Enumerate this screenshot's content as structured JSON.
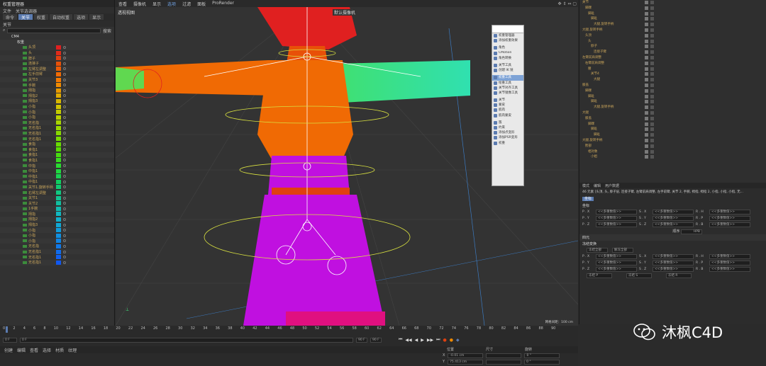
{
  "left_panel": {
    "title": "权重管理器",
    "menu": [
      "文件",
      "关节选调器"
    ],
    "tabs": [
      "命令",
      "关节",
      "权重",
      "自动权重",
      "选项",
      "显示"
    ],
    "active_tab": "关节",
    "section": "关节",
    "search_label": "搜索",
    "root": "CM4",
    "group": "权重",
    "joints": [
      {
        "name": "头顶",
        "color": "#e02020"
      },
      {
        "name": "头",
        "color": "#e02a1a"
      },
      {
        "name": "脖子",
        "color": "#e04010"
      },
      {
        "name": "连接子",
        "color": "#e85008"
      },
      {
        "name": "左臂左调整",
        "color": "#ec5c06"
      },
      {
        "name": "左手前臂",
        "color": "#f06a04"
      },
      {
        "name": "关节3",
        "color": "#f47a02"
      },
      {
        "name": "手腕",
        "color": "#f08a00"
      },
      {
        "name": "拇指",
        "color": "#e89a00"
      },
      {
        "name": "拇指2",
        "color": "#e0aa00"
      },
      {
        "name": "拇指3",
        "color": "#d8b800"
      },
      {
        "name": "小指",
        "color": "#d0c400"
      },
      {
        "name": "小指",
        "color": "#c4cc00"
      },
      {
        "name": "小指",
        "color": "#b8d000"
      },
      {
        "name": "无名指",
        "color": "#a8d400"
      },
      {
        "name": "无名指1",
        "color": "#98d800"
      },
      {
        "name": "无名指1",
        "color": "#88da00"
      },
      {
        "name": "无名指1",
        "color": "#78dc00"
      },
      {
        "name": "食指",
        "color": "#68dc00"
      },
      {
        "name": "食指1",
        "color": "#58dc00"
      },
      {
        "name": "食指1",
        "color": "#48dc10"
      },
      {
        "name": "食指1",
        "color": "#38dc20"
      },
      {
        "name": "中指",
        "color": "#28dc30"
      },
      {
        "name": "中指1",
        "color": "#20d840"
      },
      {
        "name": "中指1",
        "color": "#18d450"
      },
      {
        "name": "中指1",
        "color": "#10d060"
      },
      {
        "name": "关节1.旋转手柄",
        "color": "#10cc70"
      },
      {
        "name": "右臂左调整",
        "color": "#10c880"
      },
      {
        "name": "关节1",
        "color": "#10c490"
      },
      {
        "name": "关节2",
        "color": "#10c0a0"
      },
      {
        "name": "1手腕",
        "color": "#10bcb0"
      },
      {
        "name": "拇指",
        "color": "#10b8c0"
      },
      {
        "name": "拇指2",
        "color": "#10b0cc"
      },
      {
        "name": "拇指3",
        "color": "#10a8d4"
      },
      {
        "name": "小指",
        "color": "#109cdc"
      },
      {
        "name": "小指",
        "color": "#1090e0"
      },
      {
        "name": "小指",
        "color": "#1084e4"
      },
      {
        "name": "无名指",
        "color": "#1078e8"
      },
      {
        "name": "无名指1",
        "color": "#106cec"
      },
      {
        "name": "无名指1",
        "color": "#1060f0"
      },
      {
        "name": "无名指1",
        "color": "#1058f0"
      }
    ]
  },
  "viewport": {
    "menu": [
      "查看",
      "摄像机",
      "显示",
      "选项",
      "过滤",
      "面板",
      "ProRender"
    ],
    "highlight_menu": "选项",
    "camera_label": "透视视图",
    "camera_name": "默认摄像机",
    "grid_label": "网格间距：100 cm"
  },
  "context_menu": {
    "items": [
      "权重管理器",
      "添加权重效果",
      "",
      "角色",
      "CMotion",
      "角色转换",
      "",
      "关节工具",
      "创建 IK 链",
      "",
      "权重工具",
      "绘重工具",
      "关节对齐工具",
      "关节镜像工具",
      "",
      "关节",
      "蒙皮",
      "肌肉",
      "肌肉蒙皮",
      "",
      "簇",
      "约束",
      "添加点变形",
      "添加PSR变形",
      "权重"
    ],
    "selected": "权重工具"
  },
  "object_manager": {
    "rows": [
      "关节",
      "脚踝",
      "脚趾",
      "脚趾",
      "大腿.旋转手柄",
      "大腿.旋转手柄",
      "头顶",
      "头",
      "脖子",
      "连接子臂",
      "左臂前肩调整",
      "右臂前肩调整",
      "腰",
      "关节4",
      "大腿",
      "膝盖",
      "脚踝",
      "脚趾",
      "脚趾",
      "大腿.旋转手柄",
      "大腿",
      "膝盖",
      "脚踝",
      "脚趾",
      "脚趾",
      "大腿.旋转手柄",
      "胯部",
      "相对象",
      "小姐"
    ]
  },
  "attributes": {
    "tabs": [
      "模式",
      "编辑",
      "用户数据"
    ],
    "header": "46 元素 [头顶, 头, 脖子层, 连接子臂, 左臂前肩调整, 左手前臂, 关节 2, 手腕, 拇指, 拇指 2, 小指, 小指, 小指, 无...",
    "sub_tab": "坐标",
    "section": "坐标",
    "rows": [
      [
        "P . X",
        "<<多重数值>>",
        "S . X",
        "<<多重数值>>",
        "R . H",
        "<<多重数值>>"
      ],
      [
        "P . Y",
        "<<多重数值>>",
        "S . Y",
        "<<多重数值>>",
        "R . P",
        "<<多重数值>>"
      ],
      [
        "P . Z",
        "<<多重数值>>",
        "S . Z",
        "<<多重数值>>",
        "R . B",
        "<<多重数值>>"
      ]
    ],
    "order_label": "顺序",
    "order_value": "HPB",
    "collapsed_section": "四元",
    "freeze_section": "冻结变换",
    "freeze_all": "冻结全部",
    "unfreeze_all": "解冻全部",
    "freeze_rows": [
      [
        "P . X",
        "<<多重数值>>",
        "S . X",
        "<<多重数值>>",
        "R . H",
        "<<多重数值>>"
      ],
      [
        "P . Y",
        "<<多重数值>>",
        "S . Y",
        "<<多重数值>>",
        "R . P",
        "<<多重数值>>"
      ],
      [
        "P . Z",
        "<<多重数值>>",
        "S . Z",
        "<<多重数值>>",
        "R . B",
        "<<多重数值>>"
      ]
    ],
    "freeze_p": "冻结 P",
    "freeze_s": "冻结 S",
    "freeze_r": "冻结 R"
  },
  "timeline": {
    "ticks": [
      "0",
      "2",
      "4",
      "6",
      "8",
      "10",
      "12",
      "14",
      "16",
      "18",
      "20",
      "22",
      "24",
      "26",
      "28",
      "30",
      "32",
      "34",
      "36",
      "38",
      "40",
      "42",
      "44",
      "46",
      "48",
      "50",
      "52",
      "54",
      "56",
      "58",
      "60",
      "62",
      "64",
      "66",
      "68",
      "70",
      "72",
      "74",
      "76",
      "78",
      "80",
      "82",
      "84",
      "86",
      "88",
      "90"
    ],
    "frame_start": "0 F",
    "frame_end": "90 F",
    "frame_max": "90 F",
    "current": "0 F",
    "tabs": [
      "创建",
      "编辑",
      "查看",
      "选择",
      "材质",
      "纹理"
    ]
  },
  "coords": {
    "headers": [
      "位置",
      "尺寸",
      "旋转"
    ],
    "x_label": "X",
    "x_pos": "-0.01 cm",
    "y_label": "Y",
    "y_pos": "75.413 cm",
    "h_value": "0 °",
    "p_value": "0 °"
  },
  "watermark": "沐枫C4D",
  "colors": {
    "accent": "#5b7bb0",
    "red": "#e02020",
    "orange": "#f06a04",
    "green_mesh": "#20d8a0",
    "magenta": "#c010e0"
  }
}
